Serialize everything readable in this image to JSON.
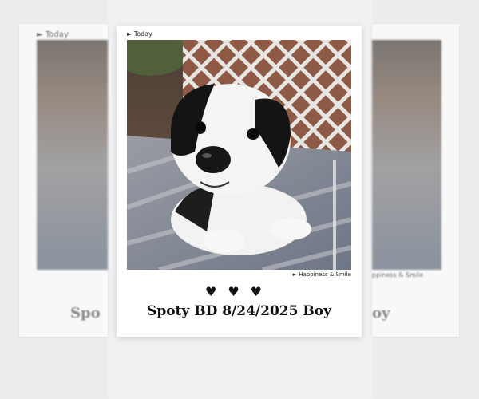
{
  "card": {
    "date_label": "Today",
    "tag_label": "Happiness & Smile",
    "hearts": "♥♥♥",
    "caption": "Spoty BD 8/24/2025 Boy"
  },
  "ghost_left": {
    "date_label": "Today",
    "caption_fragment": "Spo"
  },
  "ghost_right": {
    "tag_fragment": "ppiness & Smile",
    "caption_fragment": "oy"
  },
  "photo": {
    "subject": "black-and-white puppy lying on striped cushion",
    "background": "lattice fence"
  }
}
